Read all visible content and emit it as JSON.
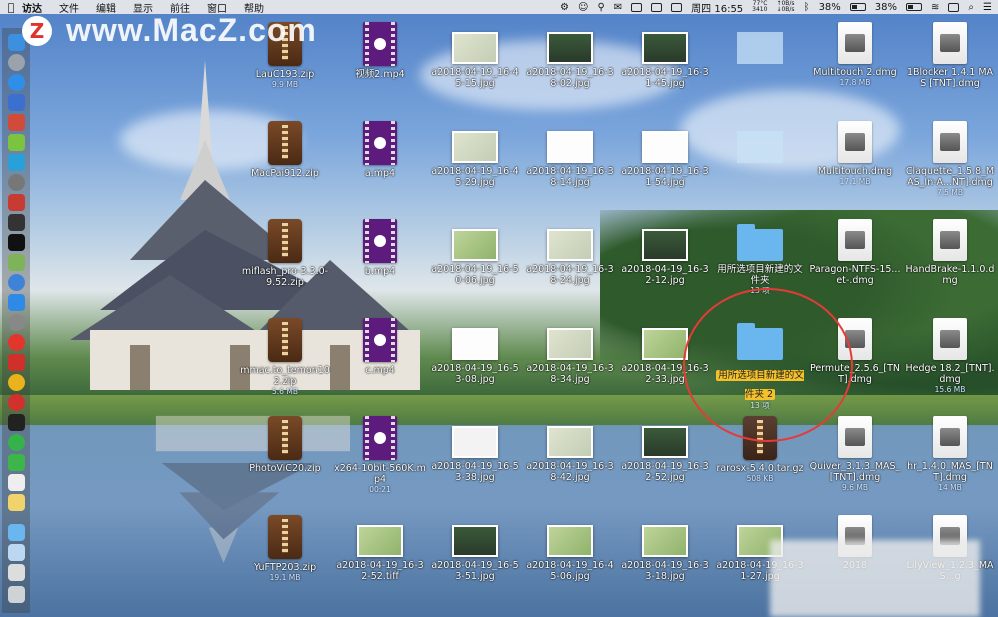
{
  "menubar": {
    "apple_icon": "apple-icon",
    "app_name": "访达",
    "items": [
      "文件",
      "编辑",
      "显示",
      "前往",
      "窗口",
      "帮助"
    ],
    "right": {
      "temp": "77°C",
      "fan": "3410",
      "net_up": "↑0B/s",
      "net_down": "↓0B/s",
      "clock": "周四 16:55",
      "battery1": "38%",
      "battery2": "38%"
    }
  },
  "watermark": {
    "logo": "Z",
    "text": "www.MacZ.com"
  },
  "desktop": {
    "col1": [
      {
        "name": "LauC193.zip",
        "size": "9.9 MB"
      },
      {
        "name": "MacPai912.zip",
        "size": ""
      },
      {
        "name": "miflash_pro-3.3.0-9.52.zip",
        "size": ""
      },
      {
        "name": "mmac.to_temon102.zip",
        "size": "5.6 MB"
      },
      {
        "name": "PhotoViC20.zip",
        "size": ""
      },
      {
        "name": "YuFTP203.zip",
        "size": "19.1 MB"
      }
    ],
    "col2": [
      {
        "name": "视频2.mp4",
        "size": ""
      },
      {
        "name": "a.mp4",
        "size": ""
      },
      {
        "name": "b.mp4",
        "size": ""
      },
      {
        "name": "c.mp4",
        "size": ""
      },
      {
        "name": "x264-10bit-560K.mp4",
        "size": "00:21"
      },
      {
        "name": "a2018-04-19_16-32-52.tiff",
        "size": ""
      }
    ],
    "col3": [
      "a2018-04-19_16-45-15.jpg",
      "a2018-04-19_16-45-29.jpg",
      "a2018-04-19_16-50-06.jpg",
      "a2018-04-19_16-53-08.jpg",
      "a2018-04-19_16-53-38.jpg",
      "a2018-04-19_16-53-51.jpg"
    ],
    "col4": [
      "a2018-04-19_16-38-02.jpg",
      "a2018-04-19_16-38-14.jpg",
      "a2018-04-19_16-38-24.jpg",
      "a2018-04-19_16-38-34.jpg",
      "a2018-04-19_16-38-42.jpg",
      "a2018-04-19_16-45-06.jpg"
    ],
    "col5": [
      "a2018-04-19_16-31-45.jpg",
      "a2018-04-19_16-31-54.jpg",
      "a2018-04-19_16-32-12.jpg",
      "a2018-04-19_16-32-33.jpg",
      "a2018-04-19_16-32-52.jpg",
      "a2018-04-19_16-33-18.jpg"
    ],
    "col6": [
      {
        "name": "用所选项目新建的文件夹",
        "size": "13 项"
      },
      {
        "name": "用所选项目新建的文件夹 2",
        "size": "13 项"
      },
      {
        "name": "rarosx-5.4.0.tar.gz",
        "size": "508 KB"
      },
      {
        "name": "a2018-04-19_16-31-27.jpg",
        "size": ""
      }
    ],
    "col7": [
      {
        "name": "Multitouch 2.dmg",
        "size": "17.8 MB"
      },
      {
        "name": "Multitouch.dmg",
        "size": "17.1 MB"
      },
      {
        "name": "Paragon-NTFS-15...et-.dmg",
        "size": ""
      },
      {
        "name": "Permute_2.5.6_[TNT].dmg",
        "size": ""
      },
      {
        "name": "Quiver_3.1.3_MAS_[TNT].dmg",
        "size": "9.6 MB"
      },
      {
        "name": "2018",
        "size": ""
      }
    ],
    "col8": [
      {
        "name": "1Blocker 1.4.1 MAS [TNT].dmg",
        "size": ""
      },
      {
        "name": "Claquette_1.5.8_MAS_In-A...NT].dmg",
        "size": "7.5 MB"
      },
      {
        "name": "HandBrake-1.1.0.dmg",
        "size": ""
      },
      {
        "name": "Hedge 18.2_[TNT].dmg",
        "size": "15.6 MB"
      },
      {
        "name": "hr_1.4.0_MAS_[TNT].dmg",
        "size": "14 MB"
      },
      {
        "name": "LilyView_1.2.3_MAS...g",
        "size": ""
      }
    ]
  }
}
